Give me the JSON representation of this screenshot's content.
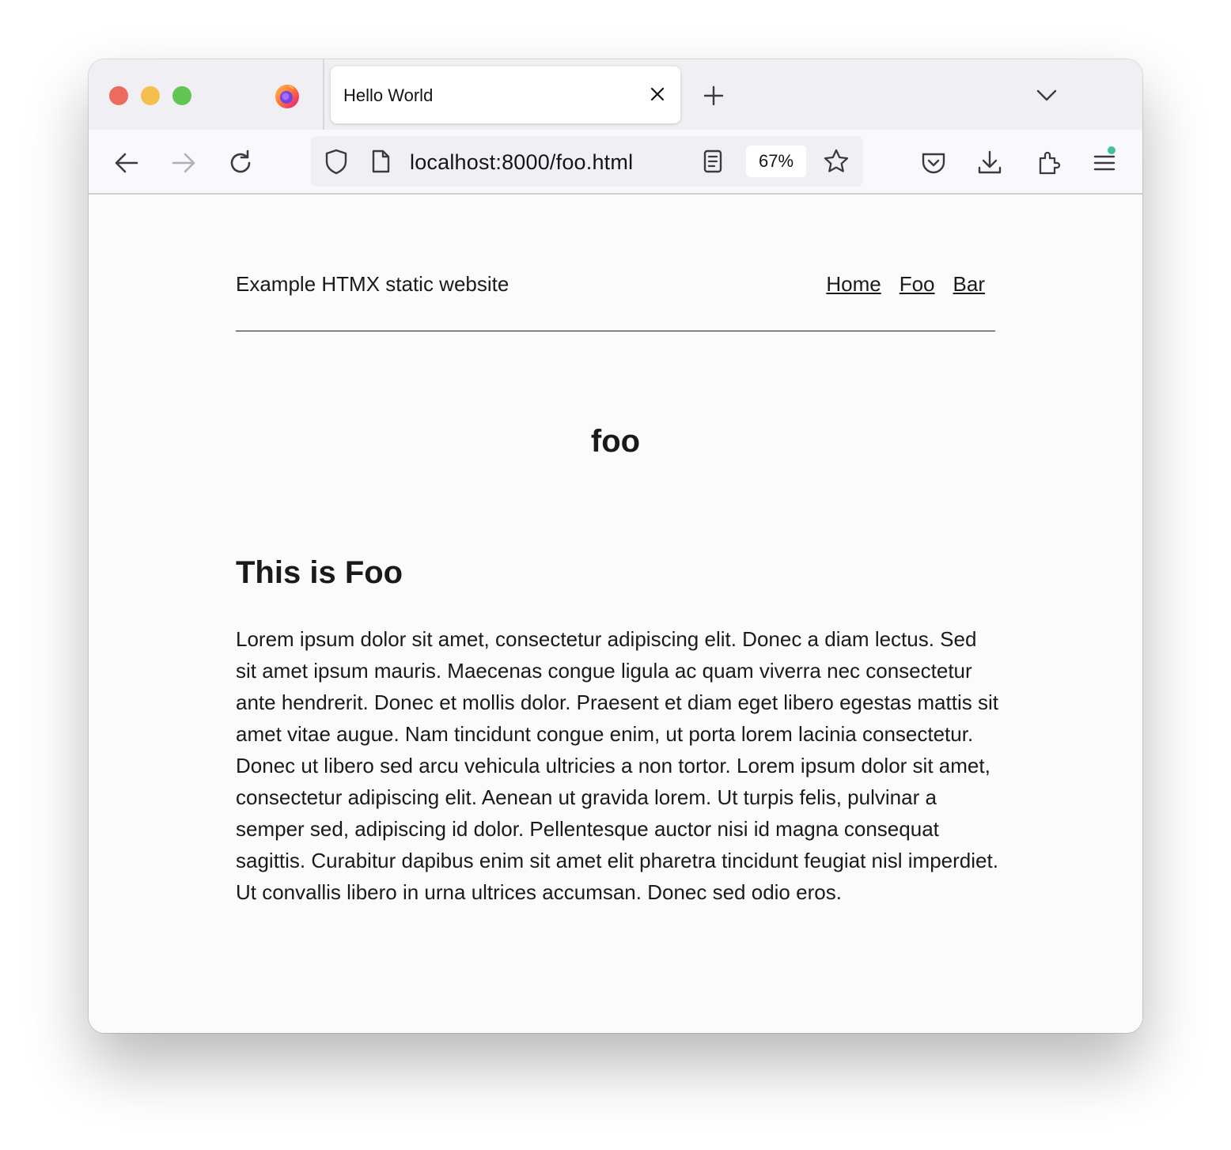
{
  "browser": {
    "tab_title": "Hello World",
    "url": "localhost:8000/foo.html",
    "zoom": "67%",
    "icons": [
      "firefox-logo",
      "close-icon",
      "plus-icon",
      "chevron-down-icon",
      "back-arrow-icon",
      "forward-arrow-icon",
      "reload-icon",
      "shield-icon",
      "page-icon",
      "reader-view-icon",
      "star-icon",
      "pocket-icon",
      "download-icon",
      "extensions-icon",
      "menu-icon"
    ],
    "colors": {
      "traffic_close": "#ed6a5e",
      "traffic_minimize": "#f5bf4f",
      "traffic_maximize": "#61c554",
      "menu_badge": "#3fc29a"
    }
  },
  "site": {
    "title": "Example HTMX static website",
    "nav": [
      "Home",
      "Foo",
      "Bar"
    ]
  },
  "main": {
    "page_heading": "foo",
    "section_heading": "This is Foo",
    "body": "Lorem ipsum dolor sit amet, consectetur adipiscing elit. Donec a diam lectus. Sed sit amet ipsum mauris. Maecenas congue ligula ac quam viverra nec consectetur ante hendrerit. Donec et mollis dolor. Praesent et diam eget libero egestas mattis sit amet vitae augue. Nam tincidunt congue enim, ut porta lorem lacinia consectetur. Donec ut libero sed arcu vehicula ultricies a non tortor. Lorem ipsum dolor sit amet, consectetur adipiscing elit. Aenean ut gravida lorem. Ut turpis felis, pulvinar a semper sed, adipiscing id dolor. Pellentesque auctor nisi id magna consequat sagittis. Curabitur dapibus enim sit amet elit pharetra tincidunt feugiat nisl imperdiet. Ut convallis libero in urna ultrices accumsan. Donec sed odio eros."
  }
}
